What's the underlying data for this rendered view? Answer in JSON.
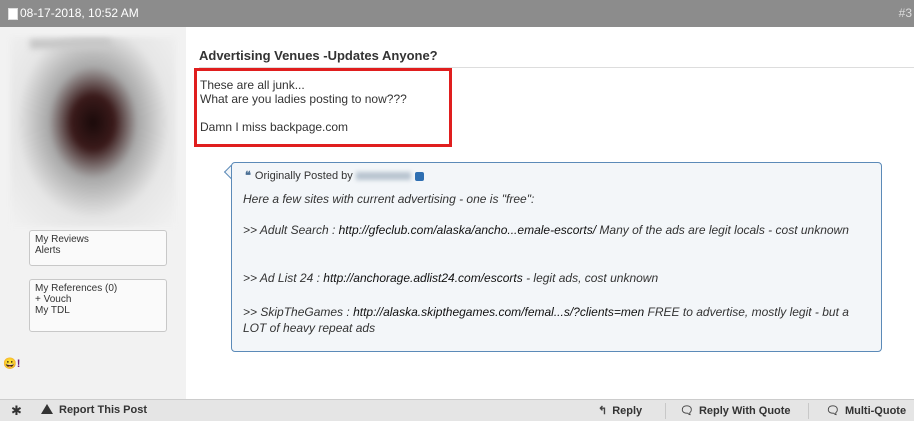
{
  "topbar": {
    "date": "08-17-2018, 10:52 AM",
    "post_number": "#3"
  },
  "sidebar": {
    "box1": {
      "items": [
        "My Reviews",
        "Alerts"
      ]
    },
    "box2": {
      "items": [
        "My References (0)",
        "+ Vouch",
        "My TDL"
      ]
    },
    "yahoo_label": "😀!"
  },
  "post": {
    "title": "Advertising Venues -Updates Anyone?",
    "lines": [
      "These are all junk...",
      "What are you ladies posting to now???",
      "Damn I miss backpage.com"
    ]
  },
  "quote": {
    "label": "Originally Posted by",
    "lines": [
      "Here a few sites with current advertising - one is \"free\":",
      ">> Adult Search : ",
      "http://gfeclub.com/alaska/ancho...emale-escorts/",
      " Many of the ads are legit locals - cost unknown",
      ">> Ad List 24 : ",
      "http://anchorage.adlist24.com/escorts",
      " - legit ads, cost unknown",
      ">> SkipTheGames : ",
      "http://alaska.skipthegames.com/femal...s/?clients=men",
      " FREE to advertise, mostly legit - but a LOT of heavy repeat ads"
    ]
  },
  "footer": {
    "report": "Report This Post",
    "reply": "Reply",
    "reply_with_quote": "Reply With Quote",
    "multi_quote": "Multi-Quote"
  }
}
